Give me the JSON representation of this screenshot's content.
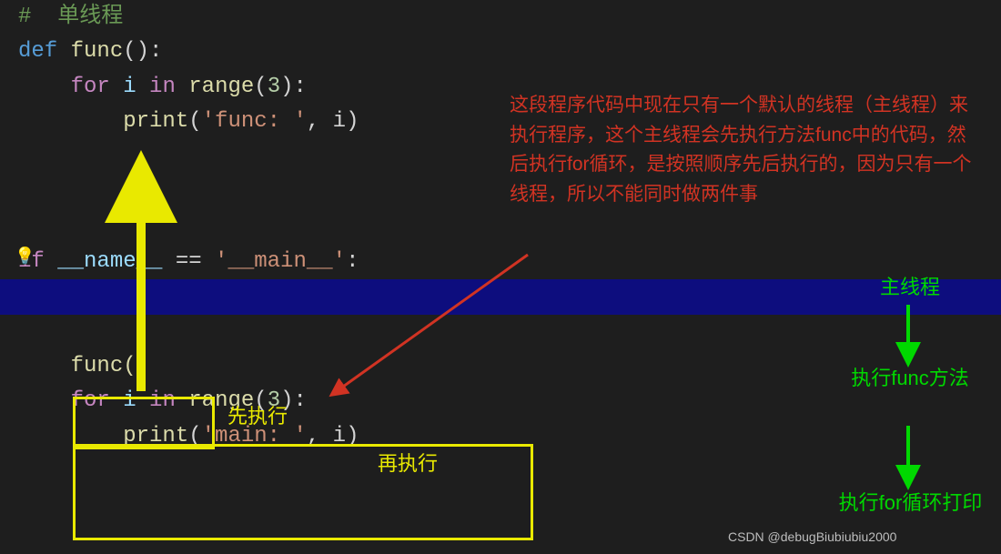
{
  "code": {
    "comment": "#  单线程",
    "kw_def": "def",
    "func_name": "func",
    "paren_colon": "():",
    "kw_for": "for",
    "var_i": "i",
    "kw_in": "in",
    "range_fn": "range",
    "lparen": "(",
    "num3": "3",
    "rparen_colon": "):",
    "print_fn": "print",
    "str_func": "'func: '",
    "comma_i_rparen": ", i)",
    "kw_if": "if",
    "name_dunder": "__name__",
    "eq": " == ",
    "main_dunder": "'__main__'",
    "colon": ":",
    "func_call": "func()",
    "str_main": "'main: '"
  },
  "annot_red": "这段程序代码中现在只有一个默认的线程（主线程）来执行程序，这个主线程会先执行方法func中的代码，然后执行for循环，是按照顺序先后执行的，因为只有一个线程，所以不能同时做两件事",
  "annot_yellow_first": "先执行",
  "annot_yellow_second": "再执行",
  "flow": {
    "main_thread": "主线程",
    "exec_func": "执行func方法",
    "exec_for": "执行for循环打印"
  },
  "watermark": "CSDN @debugBiubiubiu2000"
}
